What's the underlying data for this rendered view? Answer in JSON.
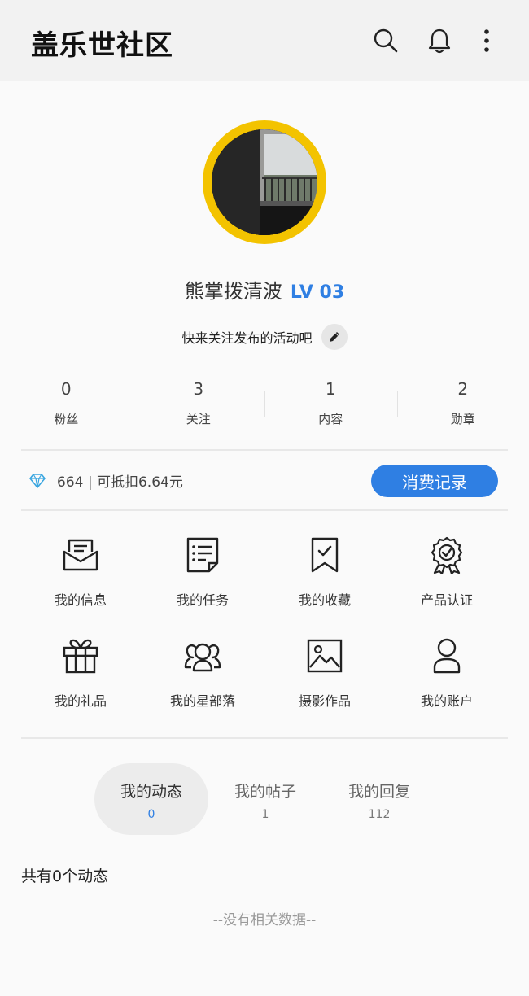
{
  "header": {
    "title": "盖乐世社区",
    "icons": [
      "search-icon",
      "bell-icon",
      "more-vert-icon"
    ]
  },
  "profile": {
    "username": "熊掌拨清波",
    "level": "LV 03",
    "bio": "快来关注发布的活动吧",
    "accent": "#2f7fe3",
    "avatar_ring": "#f3c300"
  },
  "stats": [
    {
      "value": "0",
      "label": "粉丝"
    },
    {
      "value": "3",
      "label": "关注"
    },
    {
      "value": "1",
      "label": "内容"
    },
    {
      "value": "2",
      "label": "勋章"
    }
  ],
  "points": {
    "text": "664 | 可抵扣6.64元",
    "button": "消费记录"
  },
  "menu": [
    {
      "label": "我的信息",
      "icon": "message-icon"
    },
    {
      "label": "我的任务",
      "icon": "task-list-icon"
    },
    {
      "label": "我的收藏",
      "icon": "bookmark-icon"
    },
    {
      "label": "产品认证",
      "icon": "badge-icon"
    },
    {
      "label": "我的礼品",
      "icon": "gift-icon"
    },
    {
      "label": "我的星部落",
      "icon": "group-icon"
    },
    {
      "label": "摄影作品",
      "icon": "photo-icon"
    },
    {
      "label": "我的账户",
      "icon": "user-icon"
    }
  ],
  "tabs": [
    {
      "label": "我的动态",
      "count": "0"
    },
    {
      "label": "我的帖子",
      "count": "1"
    },
    {
      "label": "我的回复",
      "count": "112"
    }
  ],
  "content": {
    "summary": "共有0个动态",
    "empty": "--没有相关数据--"
  }
}
